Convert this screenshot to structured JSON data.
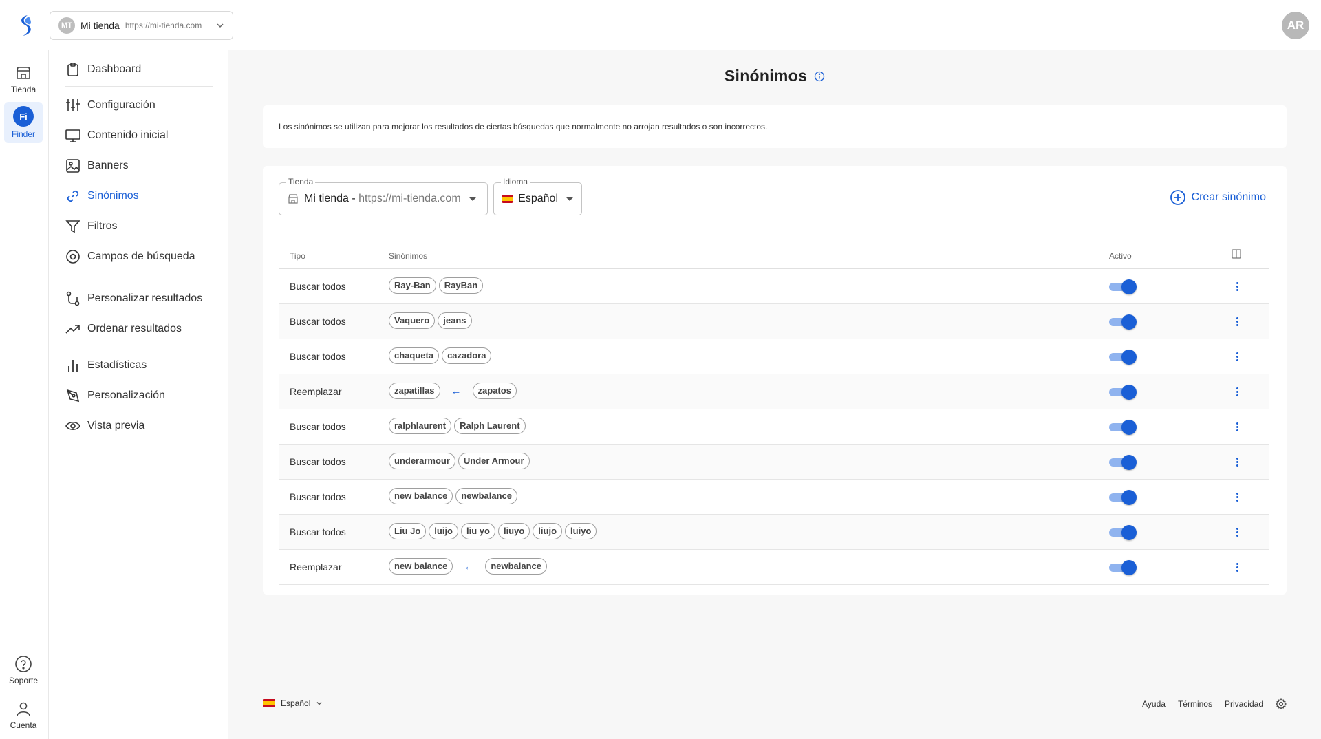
{
  "topbar": {
    "store_initials": "MT",
    "store_name": "Mi tienda",
    "store_url": "https://mi-tienda.com",
    "user_initials": "AR"
  },
  "rail": {
    "items": [
      {
        "label": "Tienda",
        "icon": "store-icon"
      },
      {
        "label": "Finder",
        "icon": "finder-icon",
        "badge": "Fi"
      },
      {
        "label": "Soporte",
        "icon": "help-icon"
      },
      {
        "label": "Cuenta",
        "icon": "user-icon"
      }
    ]
  },
  "sidebar": {
    "items": [
      {
        "label": "Dashboard",
        "icon": "clipboard-icon"
      },
      {
        "label": "Configuración",
        "icon": "sliders-icon"
      },
      {
        "label": "Contenido inicial",
        "icon": "monitor-icon"
      },
      {
        "label": "Banners",
        "icon": "image-icon"
      },
      {
        "label": "Sinónimos",
        "icon": "link-icon"
      },
      {
        "label": "Filtros",
        "icon": "filter-icon"
      },
      {
        "label": "Campos de búsqueda",
        "icon": "target-icon"
      },
      {
        "label": "Personalizar resultados",
        "icon": "route-icon"
      },
      {
        "label": "Ordenar resultados",
        "icon": "trending-icon"
      },
      {
        "label": "Estadísticas",
        "icon": "bar-chart-icon"
      },
      {
        "label": "Personalización",
        "icon": "pen-icon"
      },
      {
        "label": "Vista previa",
        "icon": "eye-icon"
      }
    ]
  },
  "page": {
    "title": "Sinónimos",
    "description": "Los sinónimos se utilizan para mejorar los resultados de ciertas búsquedas que normalmente no arrojan resultados o son incorrectos."
  },
  "filters": {
    "store_label": "Tienda",
    "store_value": "Mi tienda - ",
    "store_url": "https://mi-tienda.com",
    "language_label": "Idioma",
    "language_value": "Español"
  },
  "create_button": "Crear sinónimo",
  "table": {
    "headers": {
      "type": "Tipo",
      "synonyms": "Sinónimos",
      "active": "Activo"
    },
    "rows": [
      {
        "type": "Buscar todos",
        "mode": "all",
        "synonyms": [
          "Ray-Ban",
          "RayBan"
        ],
        "active": true
      },
      {
        "type": "Buscar todos",
        "mode": "all",
        "synonyms": [
          "Vaquero",
          "jeans"
        ],
        "active": true
      },
      {
        "type": "Buscar todos",
        "mode": "all",
        "synonyms": [
          "chaqueta",
          "cazadora"
        ],
        "active": true
      },
      {
        "type": "Reemplazar",
        "mode": "replace",
        "synonyms": [
          "zapatillas",
          "zapatos"
        ],
        "active": true
      },
      {
        "type": "Buscar todos",
        "mode": "all",
        "synonyms": [
          "ralphlaurent",
          "Ralph Laurent"
        ],
        "active": true
      },
      {
        "type": "Buscar todos",
        "mode": "all",
        "synonyms": [
          "underarmour",
          "Under Armour"
        ],
        "active": true
      },
      {
        "type": "Buscar todos",
        "mode": "all",
        "synonyms": [
          "new balance",
          "newbalance"
        ],
        "active": true
      },
      {
        "type": "Buscar todos",
        "mode": "all",
        "synonyms": [
          "Liu Jo",
          "luijo",
          "liu yo",
          "liuyo",
          "liujo",
          "luiyo"
        ],
        "active": true
      },
      {
        "type": "Reemplazar",
        "mode": "replace",
        "synonyms": [
          "new balance",
          "newbalance"
        ],
        "active": true
      }
    ]
  },
  "footer": {
    "language": "Español",
    "links": [
      "Ayuda",
      "Términos",
      "Privacidad"
    ]
  },
  "colors": {
    "accent": "#1a5fd6",
    "toggle_track": "#8fb3ef"
  }
}
